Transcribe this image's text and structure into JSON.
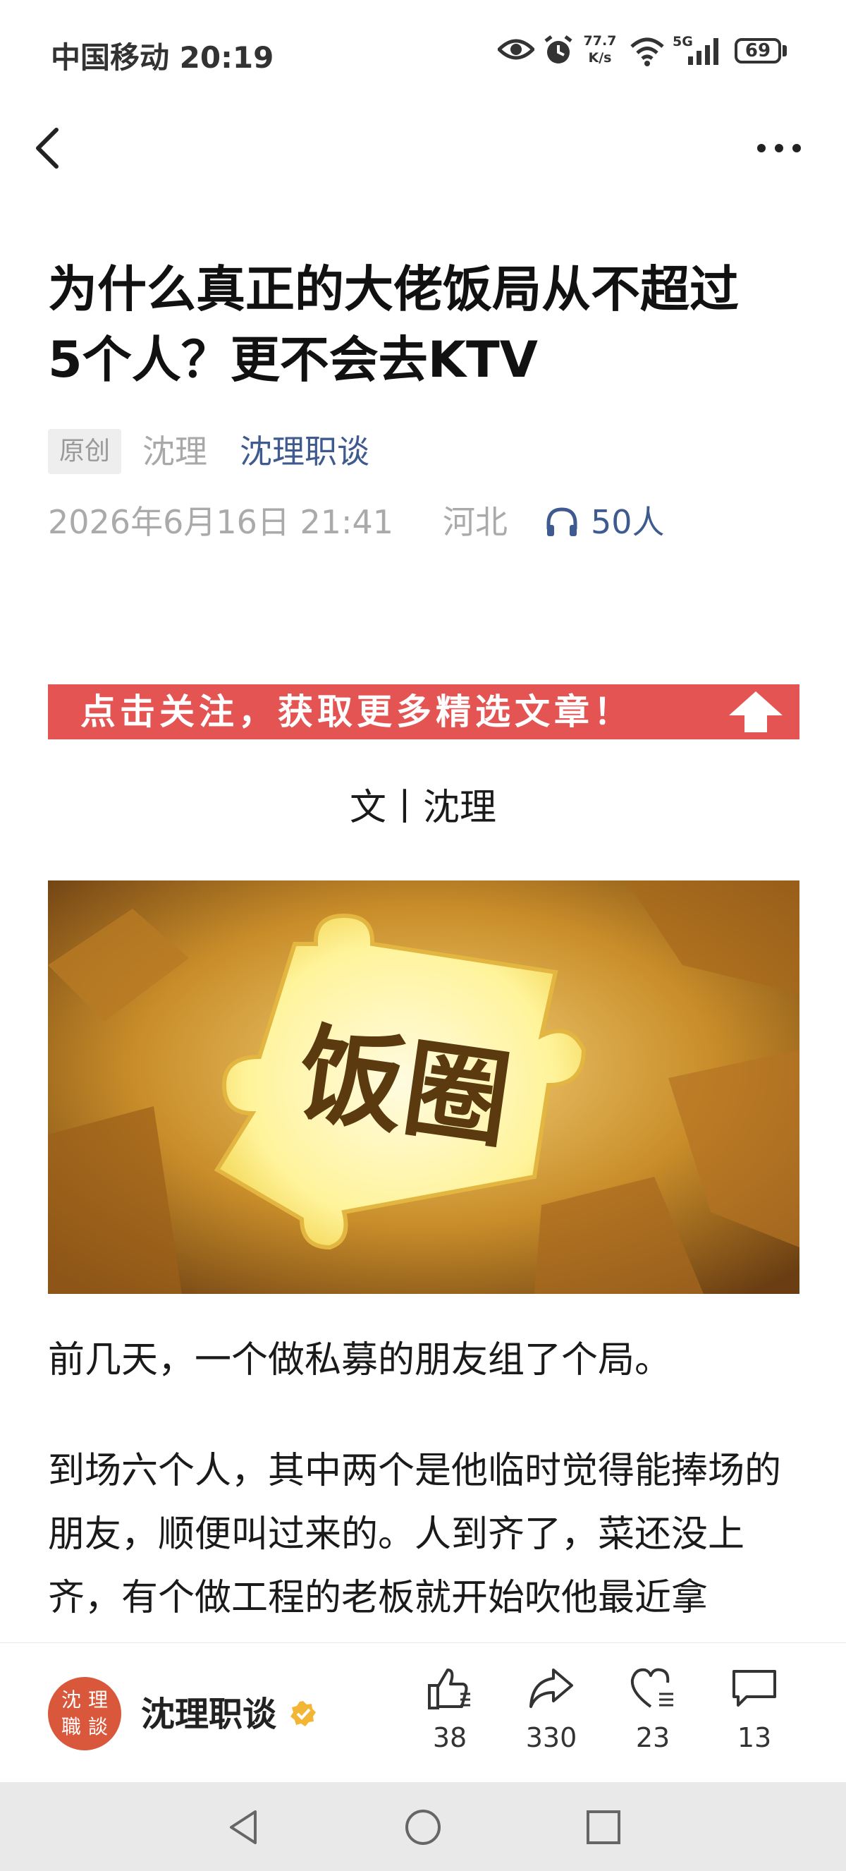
{
  "status_bar": {
    "carrier_time": "中国移动 20:19",
    "net_speed_value": "77.7",
    "net_speed_unit": "K/s",
    "network": "5G",
    "battery": "69",
    "icons": [
      "eye-icon",
      "alarm-icon",
      "wifi-icon",
      "signal-icon",
      "battery-icon"
    ]
  },
  "nav": {
    "back_icon": "chevron-left-icon",
    "more_icon": "more-dots-icon"
  },
  "article": {
    "title_line1": "为什么真正的大佬饭局从不超过",
    "title_line2": "5个人？更不会去KTV",
    "original_badge": "原创",
    "author": "沈理",
    "account": "沈理职谈",
    "date": "2026年6月16日 21:41",
    "region": "河北",
    "listen_count": "50人",
    "follow_banner": "点击关注，获取更多精选文章！",
    "byline": "文丨沈理",
    "image_text": "饭圈",
    "para1": "前几天，一个做私募的朋友组了个局。",
    "para2": "到场六个人，其中两个是他临时觉得能捧场的朋友，顺便叫过来的。人到齐了，菜还没上齐，有个做工程的老板就开始吹他最近拿"
  },
  "bottom_bar": {
    "account_name": "沈理职谈",
    "avatar_text": [
      "沈",
      "理",
      "職",
      "談"
    ],
    "actions": [
      {
        "icon": "thumbs-up-icon",
        "count": "38"
      },
      {
        "icon": "share-icon",
        "count": "330"
      },
      {
        "icon": "heart-icon",
        "count": "23"
      },
      {
        "icon": "comment-icon",
        "count": "13"
      }
    ]
  },
  "colors": {
    "accent_blue": "#3f5a8f",
    "banner_red": "#e35453",
    "gold": "#d9a441"
  }
}
